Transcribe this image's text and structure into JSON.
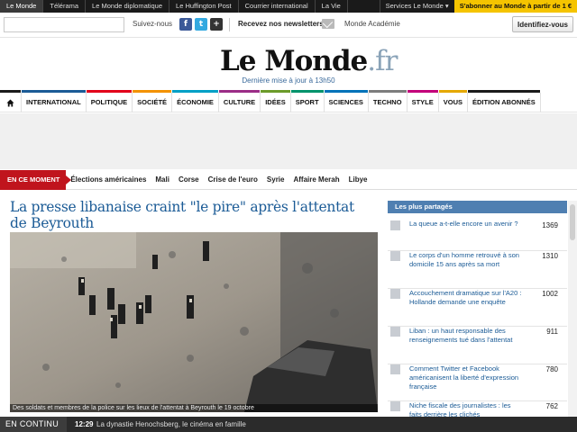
{
  "topbar": {
    "links": [
      "Le Monde",
      "Télérama",
      "Le Monde diplomatique",
      "Le Huffington Post",
      "Courrier international",
      "La Vie"
    ],
    "services": "Services Le Monde ▾",
    "subscribe": "S'abonner au Monde à partir de 1 €"
  },
  "header": {
    "search_placeholder": "",
    "follow": "Suivez-nous",
    "social_icons": [
      "facebook-icon",
      "twitter-icon",
      "plus-icon"
    ],
    "newsletters": "Recevez nos newsletters",
    "academie": "Monde Académie",
    "identify": "Identifiez-vous"
  },
  "logo": {
    "main": "Le Monde",
    "suffix": ".fr",
    "updated": "Dernière mise à jour à 13h50"
  },
  "nav": {
    "home_icon": "home-icon",
    "items": [
      "INTERNATIONAL",
      "POLITIQUE",
      "SOCIÉTÉ",
      "ÉCONOMIE",
      "CULTURE",
      "IDÉES",
      "SPORT",
      "SCIENCES",
      "TECHNO",
      "STYLE",
      "VOUS",
      "ÉDITION ABONNÉS"
    ],
    "colors": [
      "#1b5b96",
      "#e2001a",
      "#f39200",
      "#00a0c6",
      "#9b2d86",
      "#6b9b2a",
      "#00936b",
      "#0072b9",
      "#7d7d7d",
      "#c3007a",
      "#e5a800",
      "#1a1a1a"
    ]
  },
  "moment": {
    "label": "EN CE MOMENT",
    "items": [
      "Élections américaines",
      "Mali",
      "Corse",
      "Crise de l'euro",
      "Syrie",
      "Affaire Merah",
      "Libye"
    ]
  },
  "article": {
    "headline": "La presse libanaise craint \"le pire\" après l'attentat de Beyrouth",
    "caption": "Des soldats et membres de la police sur les lieux de l'attentat à Beyrouth le 19 octobre"
  },
  "sidebar": {
    "title": "Les plus partagés",
    "items": [
      {
        "title": "La queue a-t-elle encore un avenir ?",
        "count": "1369"
      },
      {
        "title": "Le corps d'un homme retrouvé à son domicile 15 ans après sa mort",
        "count": "1310"
      },
      {
        "title": "Accouchement dramatique sur l'A20 : Hollande demande une enquête",
        "count": "1002"
      },
      {
        "title": "Liban : un haut responsable des renseignements tué dans l'attentat",
        "count": "911"
      },
      {
        "title": "Comment Twitter et Facebook américanisent la liberté d'expression française",
        "count": "780"
      },
      {
        "title": "Niche fiscale des journalistes : les faits derrière les clichés",
        "count": "762"
      }
    ]
  },
  "ticker": {
    "label": "EN CONTINU",
    "time": "12:29",
    "text": "La dynastie Henochsberg, le cinéma en famille"
  }
}
